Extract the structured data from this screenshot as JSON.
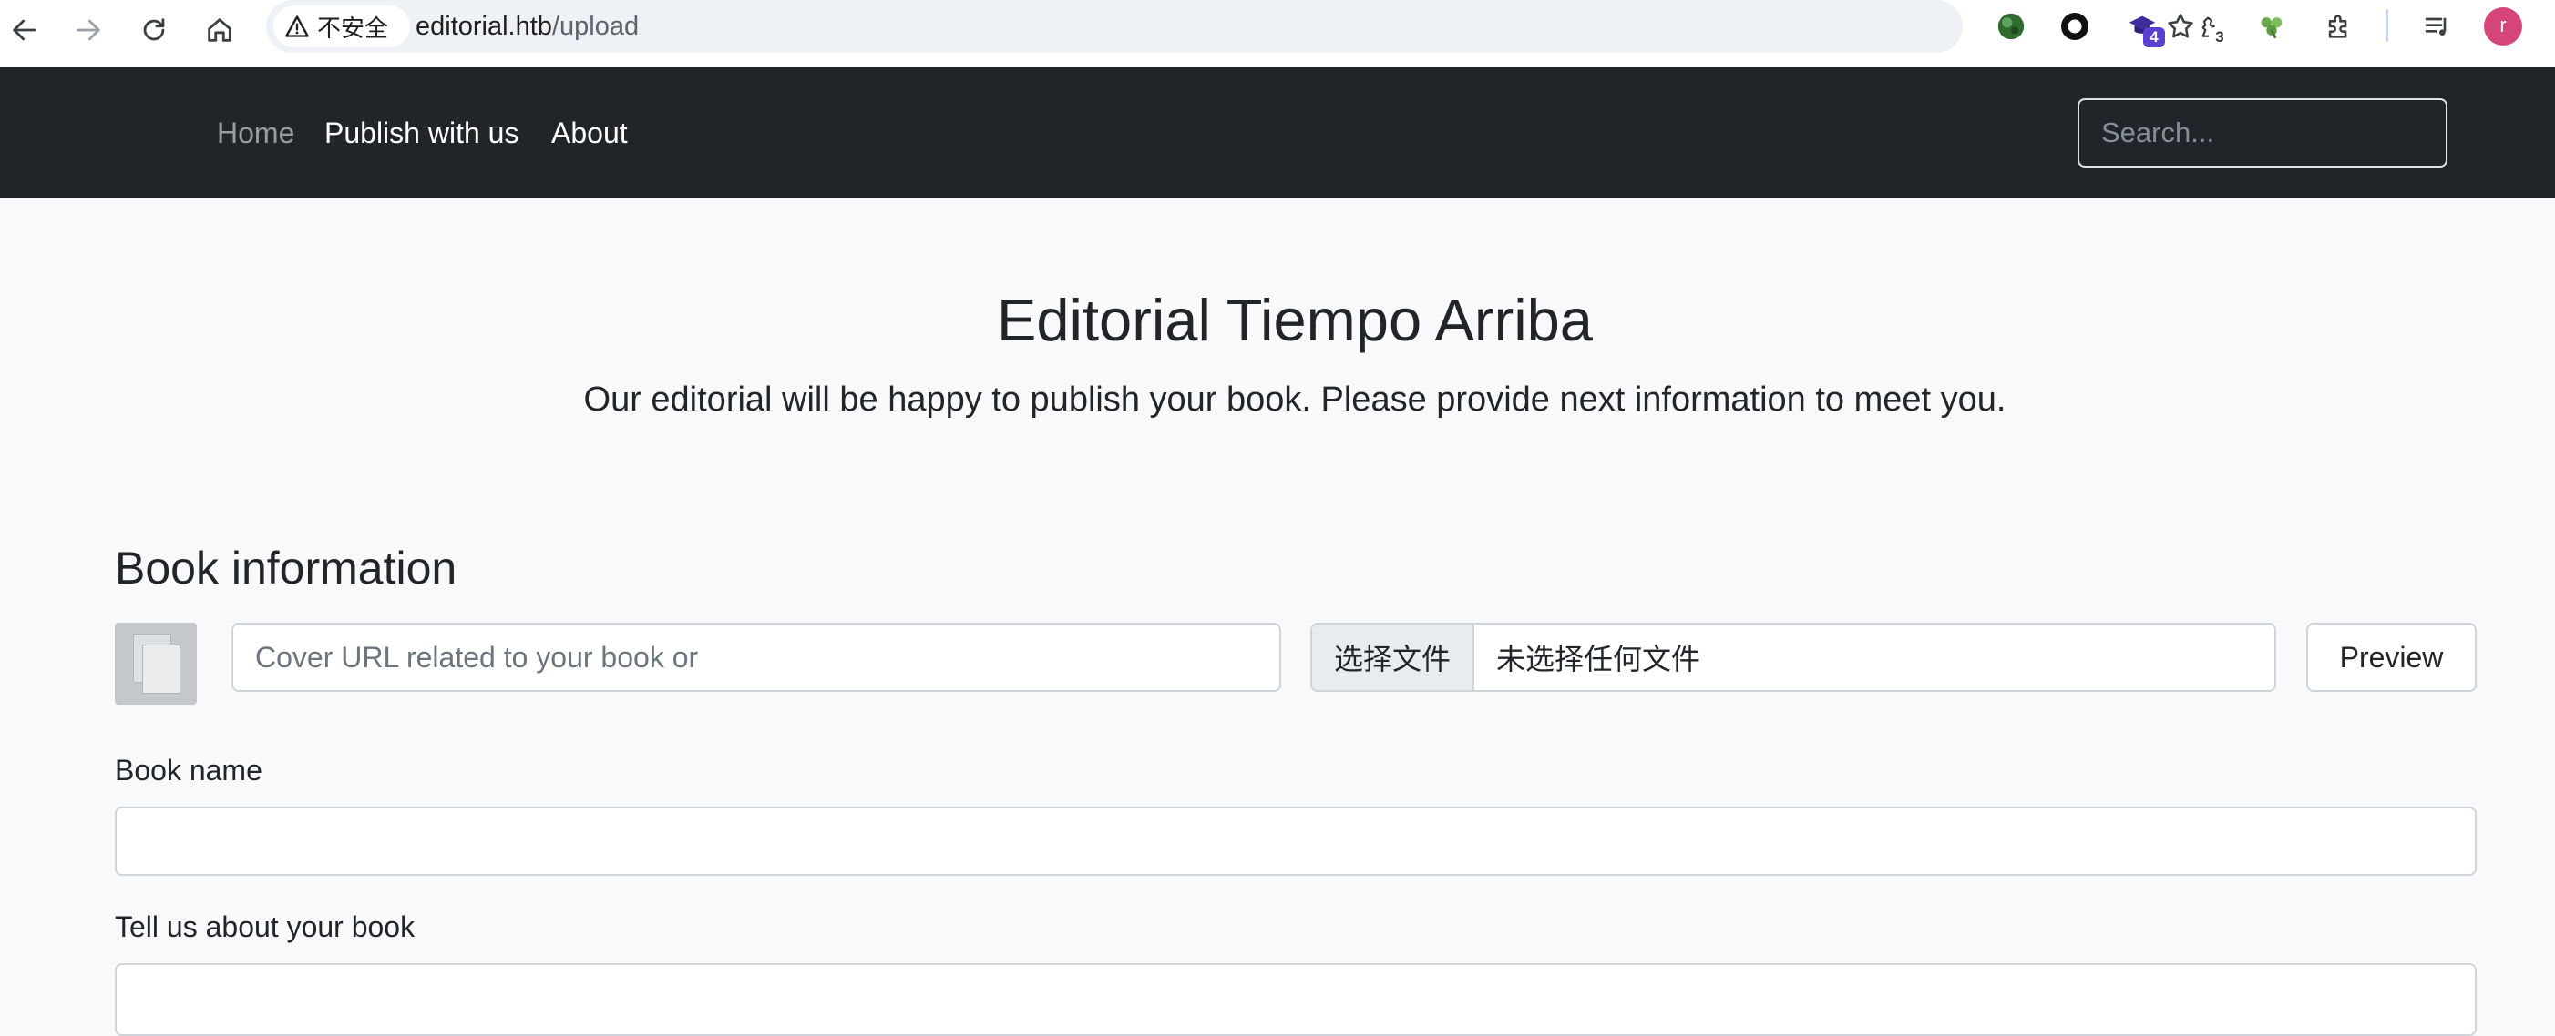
{
  "browser": {
    "security_label": "不安全",
    "url_host": "editorial.htb",
    "url_path": "/upload",
    "extensions": [
      {
        "icon": "green-globe-extension-icon"
      },
      {
        "icon": "ring-extension-icon"
      },
      {
        "icon": "graduation-cap-extension-icon",
        "badge": "4",
        "badge_color": "#5b3fd0"
      },
      {
        "icon": "chess-piece-extension-icon",
        "badge": "3",
        "badge_color": "#ffffff"
      },
      {
        "icon": "clover-extension-icon"
      },
      {
        "icon": "puzzle-extensions-icon"
      }
    ],
    "profile_initial": "r",
    "profile_color": "#d6457a"
  },
  "navbar": {
    "links": [
      "Home",
      "Publish with us",
      "About"
    ],
    "search_placeholder": "Search...",
    "background": "#212529"
  },
  "hero": {
    "title": "Editorial Tiempo Arriba",
    "subtitle": "Our editorial will be happy to publish your book. Please provide next information to meet you."
  },
  "form": {
    "section_title": "Book information",
    "cover_url_placeholder": "Cover URL related to your book or",
    "file_button_label": "选择文件",
    "file_status": "未选择任何文件",
    "preview_label": "Preview",
    "book_name_label": "Book name",
    "book_name_value": "",
    "about_label": "Tell us about your book"
  }
}
